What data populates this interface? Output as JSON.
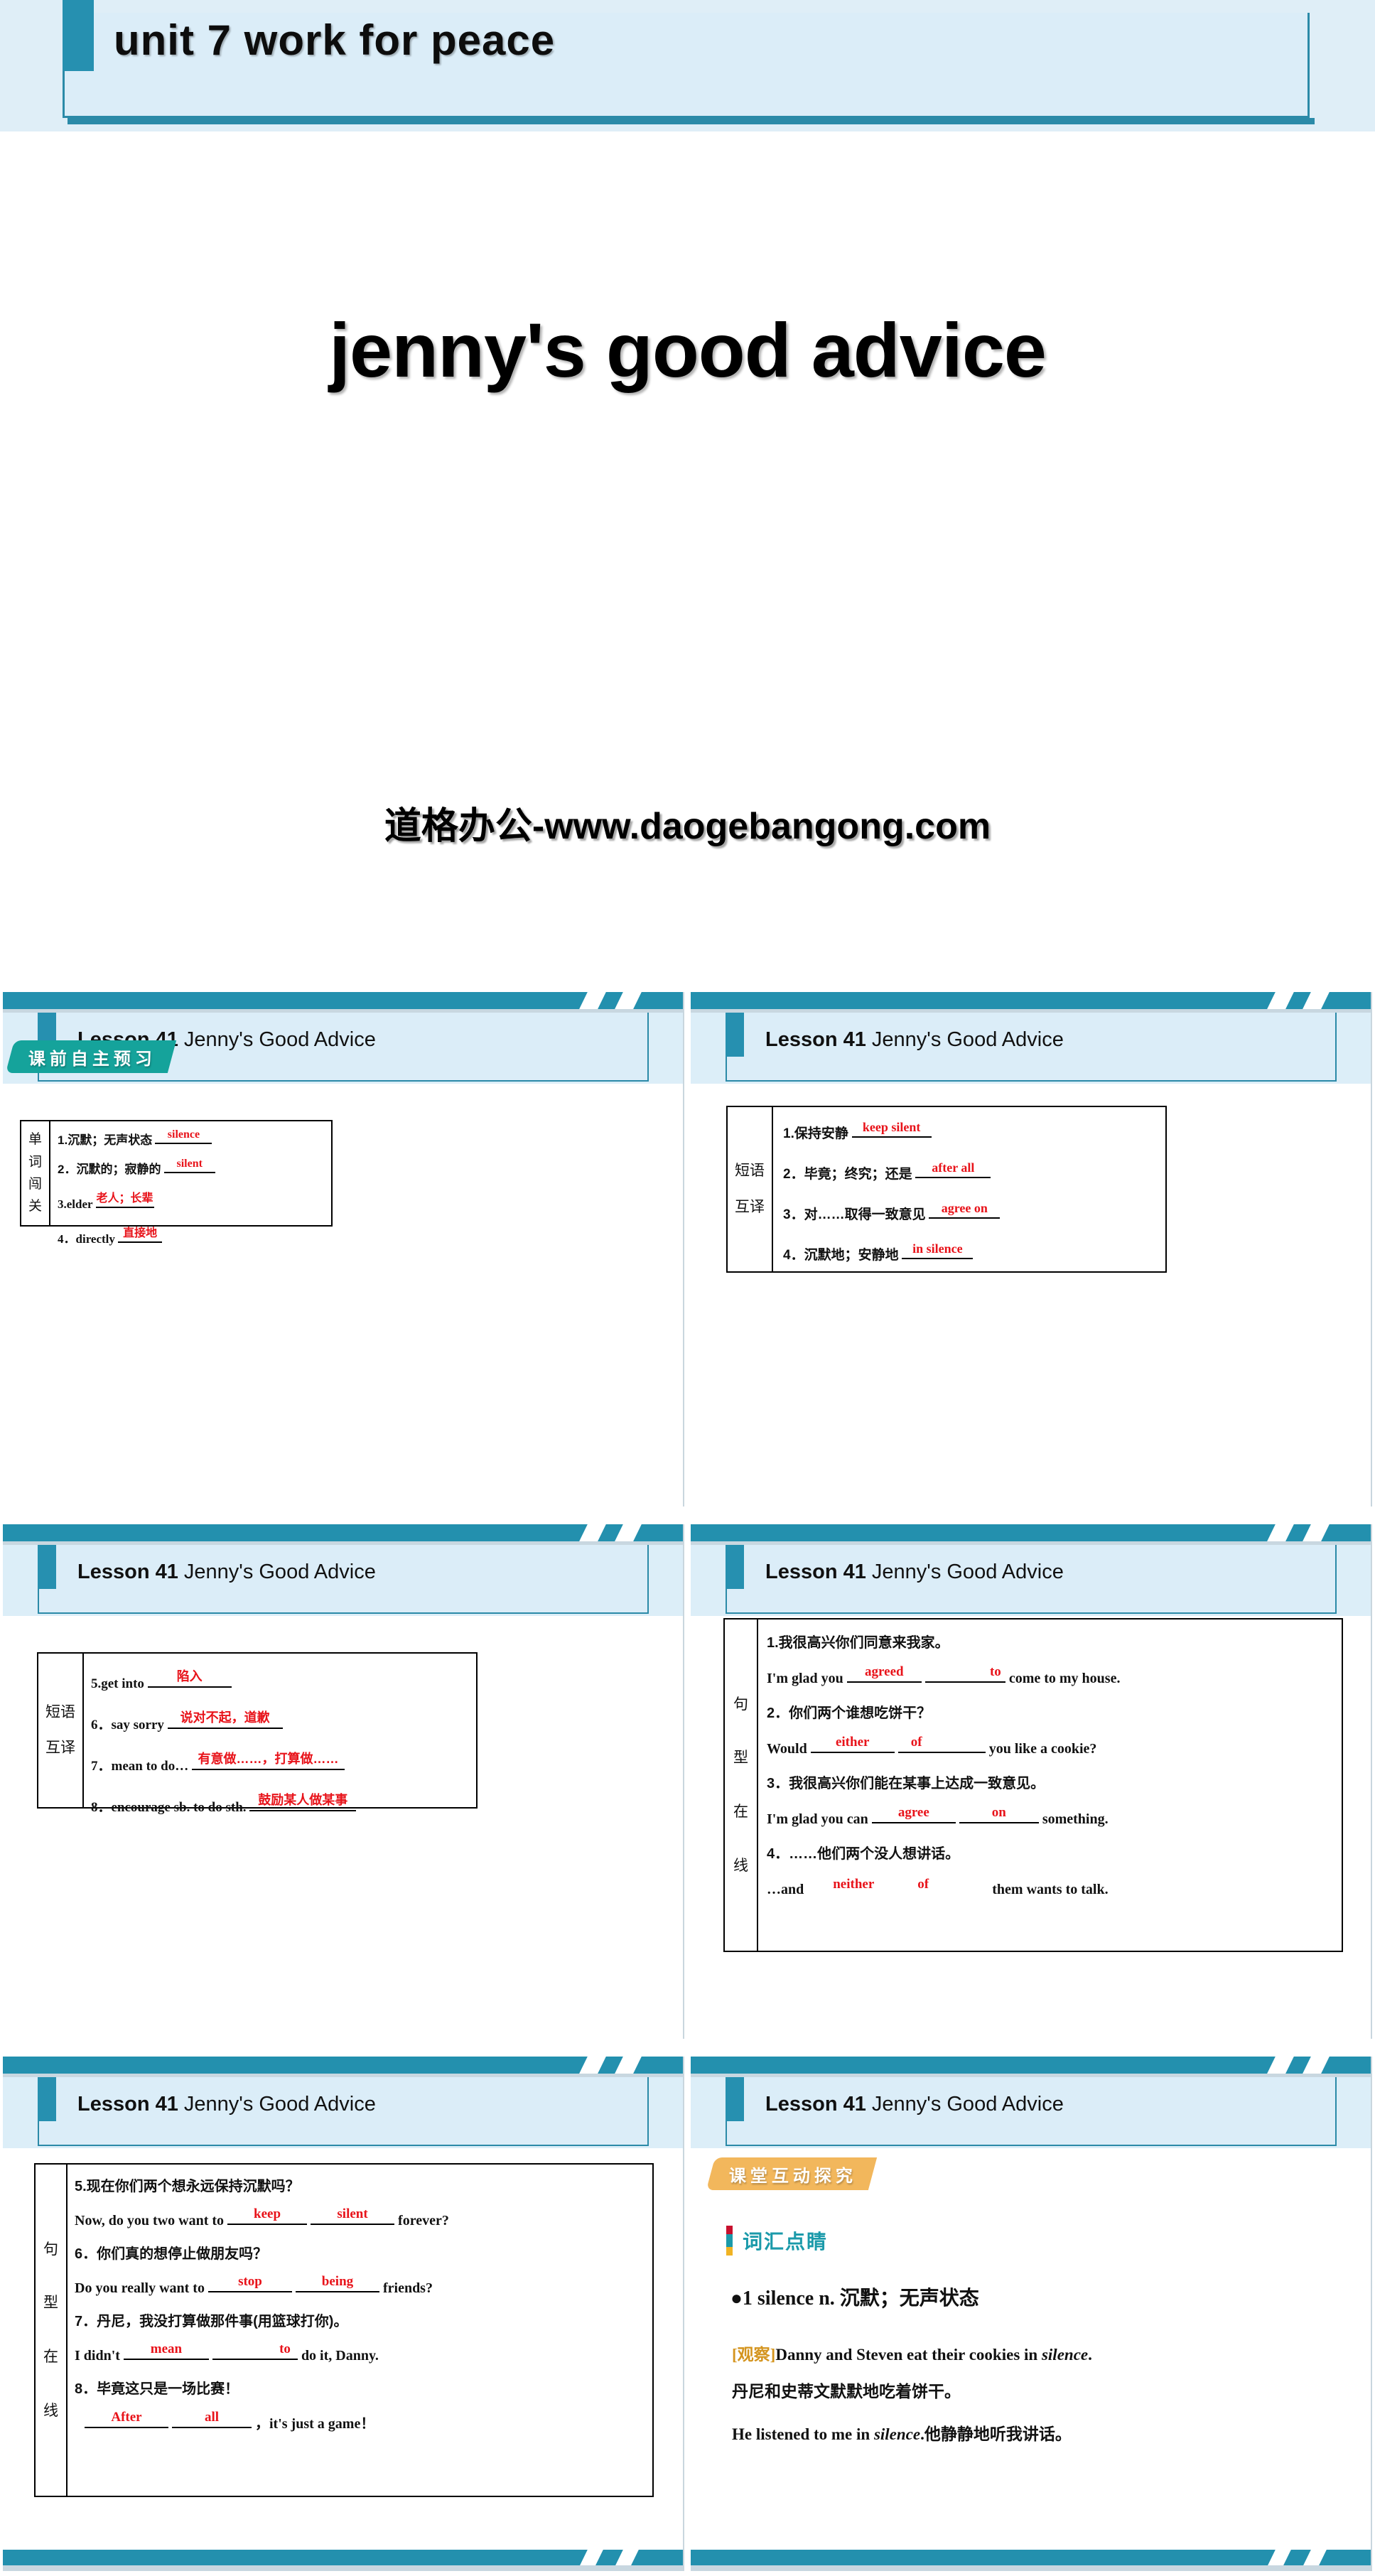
{
  "title_slide": {
    "header_title": "unit 7   work  for  peace",
    "main_title": "jenny's good advice",
    "watermark": "道格办公-www.daogebangong.com"
  },
  "common": {
    "lesson_bold": "Lesson 41",
    "lesson_rest": " Jenny's Good Advice"
  },
  "colors": {
    "teal_strip": "#2390ae",
    "header_band": "#dceef8",
    "accent": "#2690b0",
    "answer_red": "#e8131a",
    "badge_teal": "#15a39b",
    "badge_orange": "#f2b75c",
    "vocab_heading": "#1b9aaa",
    "observe_tag": "#d4941e"
  },
  "slides": [
    {
      "id": "slide-1",
      "badge": {
        "text": "课前自主预习",
        "style": "teal"
      },
      "table": {
        "label_chars": [
          "单",
          "词",
          "闯",
          "关"
        ],
        "rows": [
          {
            "prompt": "1.沉默；无声状态",
            "answer": "silence",
            "answer_lang": "en"
          },
          {
            "prompt": "2．沉默的；寂静的",
            "answer": "silent",
            "answer_lang": "en"
          },
          {
            "prompt": "3.elder",
            "answer": "老人；长辈",
            "answer_lang": "cn"
          },
          {
            "prompt": "4．directly",
            "answer": "直接地",
            "answer_lang": "cn"
          }
        ]
      }
    },
    {
      "id": "slide-2",
      "table": {
        "label_chars": [
          "短语",
          "互译"
        ],
        "rows": [
          {
            "prompt": "1.保持安静",
            "answer": "keep silent",
            "answer_lang": "en"
          },
          {
            "prompt": "2．毕竟；终究；还是",
            "answer": "after all",
            "answer_lang": "en"
          },
          {
            "prompt": "3．对……取得一致意见",
            "answer": "agree on",
            "answer_lang": "en"
          },
          {
            "prompt": "4．沉默地；安静地",
            "answer": "in silence",
            "answer_lang": "en"
          }
        ]
      }
    },
    {
      "id": "slide-3",
      "table": {
        "label_chars": [
          "短语",
          "互译"
        ],
        "rows": [
          {
            "prompt": "5.get into",
            "answer": "陷入",
            "answer_lang": "cn"
          },
          {
            "prompt": "6．say sorry",
            "answer": "说对不起，道歉",
            "answer_lang": "cn"
          },
          {
            "prompt": "7．mean to do…",
            "answer": "有意做……，打算做……",
            "answer_lang": "cn"
          },
          {
            "prompt": "8．encourage sb. to do sth.",
            "answer": "鼓励某人做某事",
            "answer_lang": "cn"
          }
        ]
      }
    },
    {
      "id": "slide-4",
      "table": {
        "label_chars": [
          "句",
          "型",
          "在",
          "线"
        ],
        "items": [
          {
            "cn": "1.我很高兴你们同意来我家。",
            "en_pre": "I'm glad you",
            "blank1": "agreed",
            "blank2": "to",
            "en_post": "come to my house."
          },
          {
            "cn": "2．你们两个谁想吃饼干？",
            "en_pre": "Would",
            "blank1": "either",
            "blank2": "of",
            "en_post": "you like a cookie?"
          },
          {
            "cn": "3．我很高兴你们能在某事上达成一致意见。",
            "en_pre": "I'm glad you can",
            "blank1": "agree",
            "blank2": "on",
            "en_post": "something."
          },
          {
            "cn": "4．……他们两个没人想讲话。",
            "en_pre": "…and",
            "blank1": "neither",
            "blank2": "of",
            "en_post": "them wants to talk."
          }
        ]
      }
    },
    {
      "id": "slide-5",
      "table": {
        "label_chars": [
          "句",
          "型",
          "在",
          "线"
        ],
        "items": [
          {
            "cn": "5.现在你们两个想永远保持沉默吗？",
            "en_pre": "Now, do you two want to",
            "blank1": "keep",
            "blank2": "silent",
            "en_post": "forever?"
          },
          {
            "cn": "6．你们真的想停止做朋友吗？",
            "en_pre": "Do you really want to",
            "blank1": "stop",
            "blank2": "being",
            "en_post": "friends?"
          },
          {
            "cn": "7．丹尼，我没打算做那件事(用篮球打你)。",
            "en_pre": "I didn't",
            "blank1": "mean",
            "blank2": "to",
            "en_post": "do it, Danny."
          },
          {
            "cn": "8．毕竟这只是一场比赛！",
            "en_pre": "",
            "blank1": "After",
            "blank2": "all",
            "en_post": "，it's just a game！"
          }
        ]
      }
    },
    {
      "id": "slide-6",
      "badge": {
        "text": "课堂互动探究",
        "style": "orange"
      },
      "vocab": {
        "heading": "词汇点睛",
        "entry": "●1  silence n. 沉默；无声状态",
        "examples": [
          {
            "tag": "[观察]",
            "text_before": "Danny and Steven eat their cookies in ",
            "italic": "silence",
            "text_after": "."
          },
          {
            "tag": "",
            "text_before": "丹尼和史蒂文默默地吃着饼干。",
            "italic": "",
            "text_after": ""
          },
          {
            "tag": "",
            "text_before": "He listened to me in ",
            "italic": "silence",
            "text_after": ".他静静地听我讲话。"
          }
        ]
      }
    }
  ]
}
